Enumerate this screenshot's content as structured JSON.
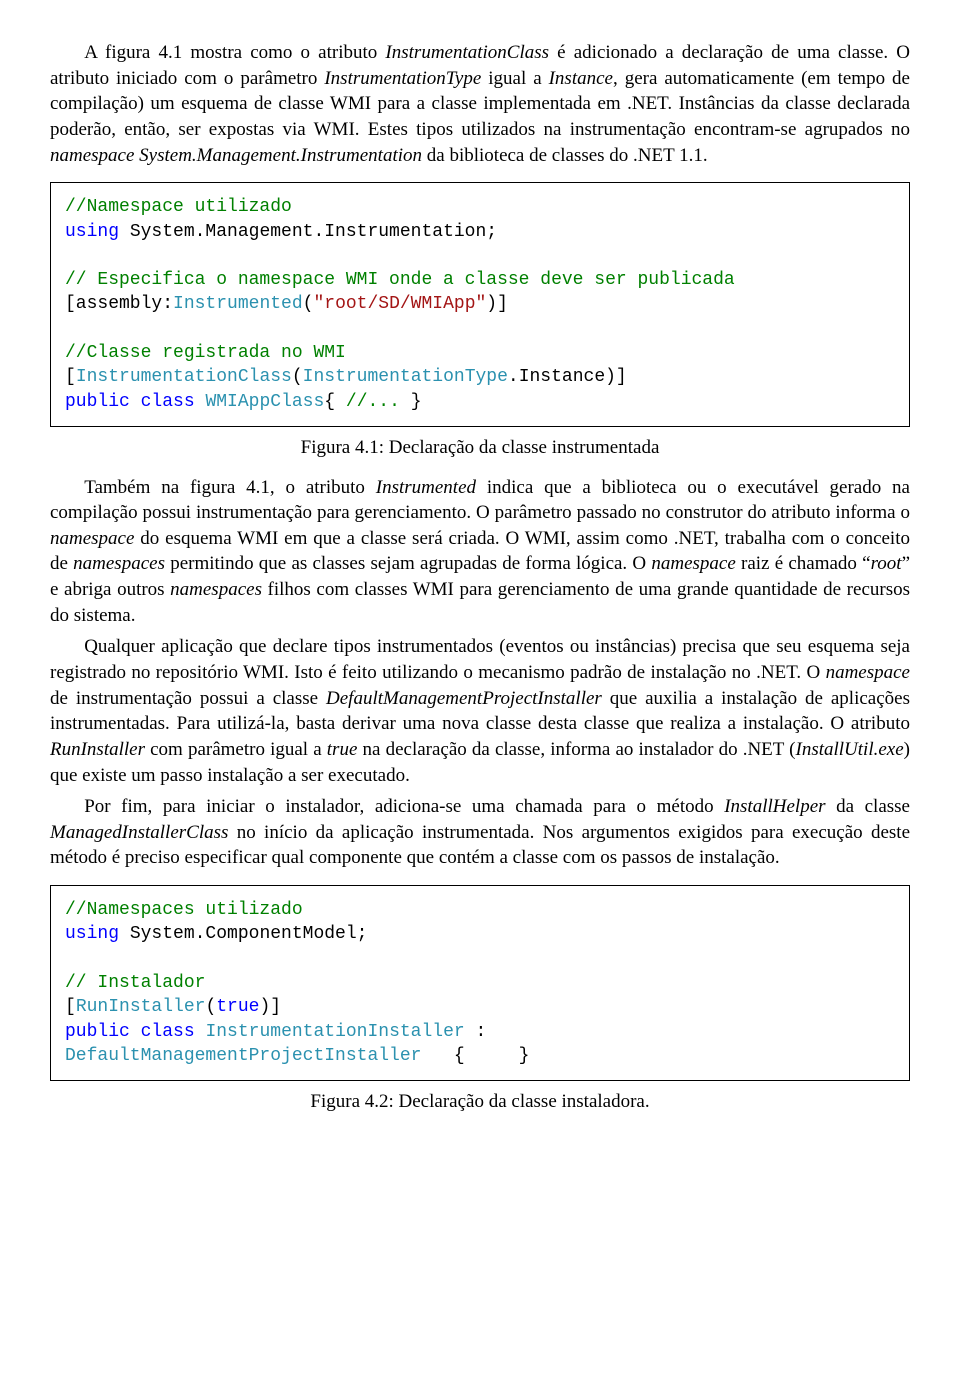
{
  "para1": {
    "t1": "A figura 4.1 mostra como o atributo ",
    "i1": "InstrumentationClass",
    "t2": " é adicionado a declaração de uma classe. O atributo iniciado com o parâmetro ",
    "i2": "InstrumentationType",
    "t3": " igual a ",
    "i3": "Instance",
    "t4": ", gera automaticamente (em tempo de compilação) um esquema de classe WMI para a classe implementada em .NET. Instâncias da classe declarada poderão, então, ser expostas via WMI. Estes tipos utilizados na instrumentação encontram-se agrupados no ",
    "i4": "namespace System.Management.Instrumentation",
    "t5": " da biblioteca de classes do .NET 1.1."
  },
  "code1": {
    "l1": "//Namespace utilizado",
    "l2a": "using",
    "l2b": " System.Management.Instrumentation;",
    "l3": "// Especifica o namespace WMI onde a classe deve ser publicada",
    "l4a": "[assembly:",
    "l4b": "Instrumented",
    "l4c": "(",
    "l4d": "\"root/SD/WMIApp\"",
    "l4e": ")]",
    "l5": "//Classe registrada no WMI",
    "l6a": "[",
    "l6b": "InstrumentationClass",
    "l6c": "(",
    "l6d": "InstrumentationType",
    "l6e": ".Instance)]",
    "l7a": "public",
    "l7b": " ",
    "l7c": "class",
    "l7d": " ",
    "l7e": "WMIAppClass",
    "l7f": "{ ",
    "l7g": "//... ",
    "l7h": "}"
  },
  "caption1": "Figura 4.1: Declaração da classe instrumentada",
  "para2": {
    "t1": "Também na figura 4.1, o atributo ",
    "i1": "Instrumented",
    "t2": " indica que a biblioteca ou o executável gerado na compilação possui instrumentação para gerenciamento. O parâmetro passado no construtor do atributo informa o ",
    "i2": "namespace",
    "t3": " do esquema WMI em que a classe será criada. O WMI, assim como .NET, trabalha com o conceito de ",
    "i3": "namespaces",
    "t4": " permitindo que as classes sejam agrupadas de forma lógica. O ",
    "i4": "namespace",
    "t5": " raiz é chamado “",
    "i5": "root",
    "t6": "” e abriga outros ",
    "i6": "namespaces",
    "t7": " filhos com classes WMI para gerenciamento de uma grande quantidade de recursos do sistema."
  },
  "para3": {
    "t1": "Qualquer aplicação que declare tipos instrumentados (eventos ou instâncias) precisa que seu esquema seja registrado no repositório WMI. Isto é feito utilizando o mecanismo padrão de instalação no .NET. O ",
    "i1": "namespace",
    "t2": " de instrumentação possui a classe ",
    "i2": "DefaultManagementProjectInstaller",
    "t3": " que auxilia a instalação de aplicações instrumentadas. Para utilizá-la, basta derivar uma nova classe desta classe que realiza a instalação. O atributo ",
    "i3": "RunInstaller",
    "t4": " com parâmetro igual a ",
    "i4": "true",
    "t5": " na declaração da classe, informa ao instalador do .NET (",
    "i5": "InstallUtil.exe",
    "t6": ") que existe um passo instalação a ser executado."
  },
  "para4": {
    "t1": "Por fim, para iniciar o instalador, adiciona-se uma chamada para o método ",
    "i1": "InstallHelper",
    "t2": " da classe ",
    "i2": "ManagedInstallerClass",
    "t3": " no início da aplicação instrumentada. Nos argumentos exigidos para execução deste método é preciso especificar qual componente que contém a classe com os passos de instalação."
  },
  "code2": {
    "l1": "//Namespaces utilizado",
    "l2a": "using",
    "l2b": " System.ComponentModel;",
    "l3": "// Instalador",
    "l4a": "[",
    "l4b": "RunInstaller",
    "l4c": "(",
    "l4d": "true",
    "l4e": ")]",
    "l5a": "public",
    "l5b": " ",
    "l5c": "class",
    "l5d": " ",
    "l5e": "InstrumentationInstaller",
    "l5f": " :",
    "l6a": "DefaultManagementProjectInstaller",
    "l6b": "   {     }"
  },
  "caption2": "Figura 4.2: Declaração da classe instaladora."
}
